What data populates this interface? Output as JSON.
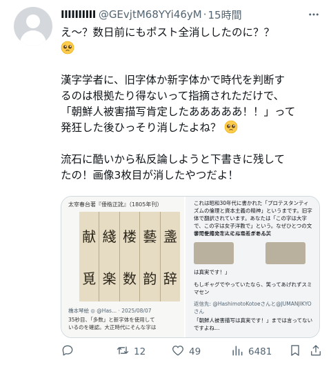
{
  "header": {
    "display_name": "ⅠⅠⅠⅠⅠⅠⅠⅠⅠⅠ",
    "handle": "@GEvjtM68YYi46yM",
    "separator": "·",
    "time": "15時間"
  },
  "tweet": {
    "para1": "え～？数日前にもポスト全消ししたのに？？",
    "para2_line1": "漢字学者に、旧字体か新字体かで時代を判断す",
    "para2_line2": "るのは根拠たり得ないって指摘されただけで、",
    "para2_line3": "「朝鮮人被害描写肯定したあああああ！！」って",
    "para2_line4": "発狂した後ひっそり消したよね？",
    "para3_line1": "流石に酷いから私反論しようと下書きに残して",
    "para3_line2": "たの！画像3枚目が消したやつだよ！",
    "emoji": "pleading-face-emoji"
  },
  "media": {
    "left": {
      "caption": "太宰春台著『倭楷正訛』（1805年刊）",
      "columns": [
        {
          "top": "盞",
          "bottom": "辞"
        },
        {
          "top": "藝",
          "bottom": "韵"
        },
        {
          "top": "楼",
          "bottom": "数"
        },
        {
          "top": "綫",
          "bottom": "楽"
        },
        {
          "top": "献",
          "bottom": "覓"
        }
      ],
      "post_meta": "橋本琴絵 ◎ @Has... · 2025/08/07",
      "post_text_1": "35秒目、「多数」と新字体を使用して",
      "post_text_2": "いるのを確認。大正時代にそんな字は"
    },
    "right": {
      "text_top": "これは昭和30年代に書かれた「プロテスタンティズムの倫理と資本主義の精神」というまです。旧字体で翻訳されています。あなたは「この字は大字で、この字は女子洋教で」という。なぜひとつの文書で使用文字にそんな差がある笑",
      "text_mid": "学問を修めた人には通じません。",
      "quote_1": "は真実です！」",
      "quote_2": "もしギャグでやっていたなら、笑ってあげれずスミマセン",
      "reply_to": "返信先: @HashimotoKotoeさんと@JUMANJIKYOさん",
      "quote_3": "「朝鮮人被害描写は真実です！」までは言ってないですよね…"
    }
  },
  "actions": {
    "reply_count": "",
    "retweet_count": "12",
    "like_count": "49",
    "views_count": "6481"
  },
  "colors": {
    "text": "#0f1419",
    "secondary": "#536471",
    "border": "#cfd9de"
  }
}
